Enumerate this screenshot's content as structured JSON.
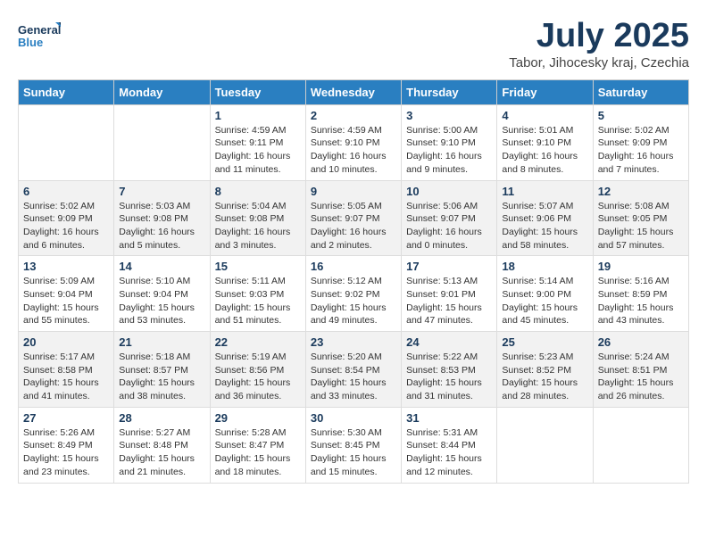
{
  "logo": {
    "line1": "General",
    "line2": "Blue"
  },
  "title": "July 2025",
  "subtitle": "Tabor, Jihocesky kraj, Czechia",
  "headers": [
    "Sunday",
    "Monday",
    "Tuesday",
    "Wednesday",
    "Thursday",
    "Friday",
    "Saturday"
  ],
  "weeks": [
    [
      {
        "num": "",
        "info": ""
      },
      {
        "num": "",
        "info": ""
      },
      {
        "num": "1",
        "info": "Sunrise: 4:59 AM\nSunset: 9:11 PM\nDaylight: 16 hours\nand 11 minutes."
      },
      {
        "num": "2",
        "info": "Sunrise: 4:59 AM\nSunset: 9:10 PM\nDaylight: 16 hours\nand 10 minutes."
      },
      {
        "num": "3",
        "info": "Sunrise: 5:00 AM\nSunset: 9:10 PM\nDaylight: 16 hours\nand 9 minutes."
      },
      {
        "num": "4",
        "info": "Sunrise: 5:01 AM\nSunset: 9:10 PM\nDaylight: 16 hours\nand 8 minutes."
      },
      {
        "num": "5",
        "info": "Sunrise: 5:02 AM\nSunset: 9:09 PM\nDaylight: 16 hours\nand 7 minutes."
      }
    ],
    [
      {
        "num": "6",
        "info": "Sunrise: 5:02 AM\nSunset: 9:09 PM\nDaylight: 16 hours\nand 6 minutes."
      },
      {
        "num": "7",
        "info": "Sunrise: 5:03 AM\nSunset: 9:08 PM\nDaylight: 16 hours\nand 5 minutes."
      },
      {
        "num": "8",
        "info": "Sunrise: 5:04 AM\nSunset: 9:08 PM\nDaylight: 16 hours\nand 3 minutes."
      },
      {
        "num": "9",
        "info": "Sunrise: 5:05 AM\nSunset: 9:07 PM\nDaylight: 16 hours\nand 2 minutes."
      },
      {
        "num": "10",
        "info": "Sunrise: 5:06 AM\nSunset: 9:07 PM\nDaylight: 16 hours\nand 0 minutes."
      },
      {
        "num": "11",
        "info": "Sunrise: 5:07 AM\nSunset: 9:06 PM\nDaylight: 15 hours\nand 58 minutes."
      },
      {
        "num": "12",
        "info": "Sunrise: 5:08 AM\nSunset: 9:05 PM\nDaylight: 15 hours\nand 57 minutes."
      }
    ],
    [
      {
        "num": "13",
        "info": "Sunrise: 5:09 AM\nSunset: 9:04 PM\nDaylight: 15 hours\nand 55 minutes."
      },
      {
        "num": "14",
        "info": "Sunrise: 5:10 AM\nSunset: 9:04 PM\nDaylight: 15 hours\nand 53 minutes."
      },
      {
        "num": "15",
        "info": "Sunrise: 5:11 AM\nSunset: 9:03 PM\nDaylight: 15 hours\nand 51 minutes."
      },
      {
        "num": "16",
        "info": "Sunrise: 5:12 AM\nSunset: 9:02 PM\nDaylight: 15 hours\nand 49 minutes."
      },
      {
        "num": "17",
        "info": "Sunrise: 5:13 AM\nSunset: 9:01 PM\nDaylight: 15 hours\nand 47 minutes."
      },
      {
        "num": "18",
        "info": "Sunrise: 5:14 AM\nSunset: 9:00 PM\nDaylight: 15 hours\nand 45 minutes."
      },
      {
        "num": "19",
        "info": "Sunrise: 5:16 AM\nSunset: 8:59 PM\nDaylight: 15 hours\nand 43 minutes."
      }
    ],
    [
      {
        "num": "20",
        "info": "Sunrise: 5:17 AM\nSunset: 8:58 PM\nDaylight: 15 hours\nand 41 minutes."
      },
      {
        "num": "21",
        "info": "Sunrise: 5:18 AM\nSunset: 8:57 PM\nDaylight: 15 hours\nand 38 minutes."
      },
      {
        "num": "22",
        "info": "Sunrise: 5:19 AM\nSunset: 8:56 PM\nDaylight: 15 hours\nand 36 minutes."
      },
      {
        "num": "23",
        "info": "Sunrise: 5:20 AM\nSunset: 8:54 PM\nDaylight: 15 hours\nand 33 minutes."
      },
      {
        "num": "24",
        "info": "Sunrise: 5:22 AM\nSunset: 8:53 PM\nDaylight: 15 hours\nand 31 minutes."
      },
      {
        "num": "25",
        "info": "Sunrise: 5:23 AM\nSunset: 8:52 PM\nDaylight: 15 hours\nand 28 minutes."
      },
      {
        "num": "26",
        "info": "Sunrise: 5:24 AM\nSunset: 8:51 PM\nDaylight: 15 hours\nand 26 minutes."
      }
    ],
    [
      {
        "num": "27",
        "info": "Sunrise: 5:26 AM\nSunset: 8:49 PM\nDaylight: 15 hours\nand 23 minutes."
      },
      {
        "num": "28",
        "info": "Sunrise: 5:27 AM\nSunset: 8:48 PM\nDaylight: 15 hours\nand 21 minutes."
      },
      {
        "num": "29",
        "info": "Sunrise: 5:28 AM\nSunset: 8:47 PM\nDaylight: 15 hours\nand 18 minutes."
      },
      {
        "num": "30",
        "info": "Sunrise: 5:30 AM\nSunset: 8:45 PM\nDaylight: 15 hours\nand 15 minutes."
      },
      {
        "num": "31",
        "info": "Sunrise: 5:31 AM\nSunset: 8:44 PM\nDaylight: 15 hours\nand 12 minutes."
      },
      {
        "num": "",
        "info": ""
      },
      {
        "num": "",
        "info": ""
      }
    ]
  ]
}
